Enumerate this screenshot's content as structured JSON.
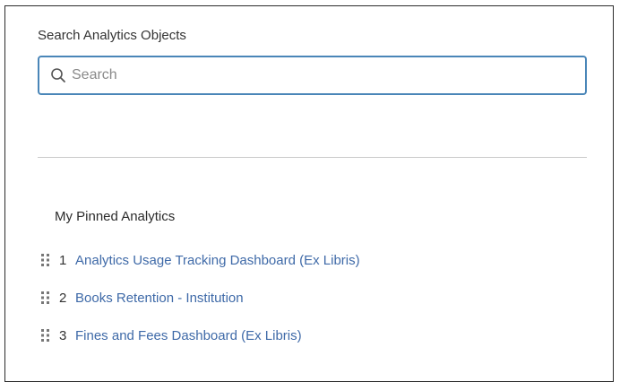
{
  "search": {
    "label": "Search Analytics Objects",
    "placeholder": "Search",
    "value": ""
  },
  "pinned": {
    "title": "My Pinned Analytics",
    "items": [
      {
        "index": "1",
        "label": "Analytics Usage Tracking Dashboard (Ex Libris)"
      },
      {
        "index": "2",
        "label": "Books Retention - Institution"
      },
      {
        "index": "3",
        "label": "Fines and Fees Dashboard (Ex Libris)"
      }
    ]
  },
  "colors": {
    "accent_border": "#4a86b8",
    "link": "#3f6aa8"
  },
  "icons": {
    "search": "search-icon",
    "drag": "drag-handle-icon"
  }
}
